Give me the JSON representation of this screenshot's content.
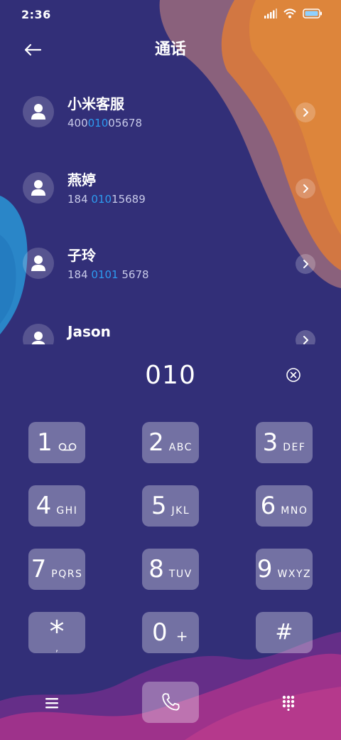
{
  "status": {
    "time": "2:36"
  },
  "header": {
    "title": "通话"
  },
  "contacts": [
    {
      "name": "小米客服",
      "number_pre": "400",
      "number_hl": "010",
      "number_post": "05678"
    },
    {
      "name": "燕婷",
      "number_pre": "184 ",
      "number_hl": "010",
      "number_post": "15689"
    },
    {
      "name": "子玲",
      "number_pre": "184 ",
      "number_hl": "0101",
      "number_post": " 5678"
    },
    {
      "name": "Jason",
      "number_pre": "",
      "number_hl": "",
      "number_post": ""
    }
  ],
  "dialer": {
    "input": "010"
  },
  "keypad": [
    {
      "digit": "1",
      "sub": ""
    },
    {
      "digit": "2",
      "sub": "ABC"
    },
    {
      "digit": "3",
      "sub": "DEF"
    },
    {
      "digit": "4",
      "sub": "GHI"
    },
    {
      "digit": "5",
      "sub": "JKL"
    },
    {
      "digit": "6",
      "sub": "MNO"
    },
    {
      "digit": "7",
      "sub": "PQRS"
    },
    {
      "digit": "8",
      "sub": "TUV"
    },
    {
      "digit": "9",
      "sub": "WXYZ"
    },
    {
      "digit": "*",
      "sub": ","
    },
    {
      "digit": "0",
      "sub": "+"
    },
    {
      "digit": "#",
      "sub": ""
    }
  ],
  "icons": {
    "back": "arrow-left-icon",
    "avatar": "person-icon",
    "detail": "chevron-right-icon",
    "clear": "clear-circle-x-icon",
    "voicemail": "voicemail-icon",
    "menu": "menu-icon",
    "call": "phone-icon",
    "keypad_toggle": "keypad-icon"
  },
  "colors": {
    "background": "#322f78",
    "highlight": "#2d9bf0",
    "orange_accent": "#e0823a",
    "blue_accent": "#2a86c8",
    "magenta_accent": "#b0348c"
  }
}
